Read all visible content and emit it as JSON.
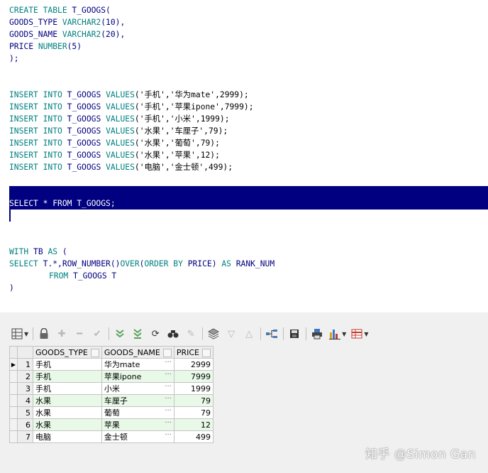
{
  "editor": {
    "create": {
      "l1": {
        "kw": "CREATE TABLE",
        "rest": " T_GOOGS("
      },
      "l2": {
        "name": "GOODS_TYPE ",
        "type": "VARCHAR2",
        "args": "(10),"
      },
      "l3": {
        "name": "GOODS_NAME ",
        "type": "VARCHAR2",
        "args": "(20),"
      },
      "l4": {
        "name": "PRICE ",
        "type": "NUMBER",
        "args": "(5)"
      },
      "l5": ");"
    },
    "inserts": [
      {
        "kw1": "INSERT",
        "kw2": "INTO",
        "table": "T_GOOGS",
        "values_kw": "VALUES",
        "args": "('手机','华为mate',2999);"
      },
      {
        "kw1": "INSERT",
        "kw2": "INTO",
        "table": "T_GOOGS",
        "values_kw": "VALUES",
        "args": "('手机','苹果ipone',7999);"
      },
      {
        "kw1": "INSERT",
        "kw2": "INTO",
        "table": "T_GOOGS",
        "values_kw": "VALUES",
        "args": "('手机','小米',1999);"
      },
      {
        "kw1": "INSERT",
        "kw2": "INTO",
        "table": "T_GOOGS",
        "values_kw": "VALUES",
        "args": "('水果','车厘子',79);"
      },
      {
        "kw1": "INSERT",
        "kw2": "INTO",
        "table": "T_GOOGS",
        "values_kw": "VALUES",
        "args": "('水果','葡萄',79);"
      },
      {
        "kw1": "INSERT",
        "kw2": "INTO",
        "table": "T_GOOGS",
        "values_kw": "VALUES",
        "args": "('水果','苹果',12);"
      },
      {
        "kw1": "INSERT",
        "kw2": "INTO",
        "table": "T_GOOGS",
        "values_kw": "VALUES",
        "args": "('电脑','金士顿',499);"
      }
    ],
    "select": "SELECT * FROM T_GOOGS;",
    "with": {
      "l1": {
        "kw": "WITH",
        "mid": " TB ",
        "kw2": "AS",
        "rest": " ("
      },
      "l2": {
        "kw": "SELECT",
        "mid": " T.*,ROW_NUMBER()",
        "kw2": "OVER",
        "p1": "(",
        "kw3": "ORDER BY",
        "p2": " PRICE) ",
        "kw4": "AS",
        "rest": " RANK_NUM"
      },
      "l3": {
        "kw": "FROM",
        "rest": " T_GOOGS T"
      },
      "l4": ")"
    }
  },
  "grid": {
    "columns": [
      "GOODS_TYPE",
      "GOODS_NAME",
      "PRICE"
    ],
    "rows": [
      {
        "n": "1",
        "type": "手机",
        "name": "华为mate",
        "price": "2999"
      },
      {
        "n": "2",
        "type": "手机",
        "name": "苹果ipone",
        "price": "7999"
      },
      {
        "n": "3",
        "type": "手机",
        "name": "小米",
        "price": "1999"
      },
      {
        "n": "4",
        "type": "水果",
        "name": "车厘子",
        "price": "79"
      },
      {
        "n": "5",
        "type": "水果",
        "name": "葡萄",
        "price": "79"
      },
      {
        "n": "6",
        "type": "水果",
        "name": "苹果",
        "price": "12"
      },
      {
        "n": "7",
        "type": "电脑",
        "name": "金士顿",
        "price": "499"
      }
    ],
    "cell_button": "···",
    "current_row_marker": "▶"
  },
  "toolbar": {
    "icons": [
      "grid-layout-icon",
      "lock-icon",
      "add-record-icon",
      "delete-record-icon",
      "post-changes-icon",
      "fetch-next-icon",
      "fetch-all-icon",
      "refresh-icon",
      "find-icon",
      "clear-icon",
      "query-by-example-icon",
      "filter-icon",
      "previous-icon",
      "link-icon",
      "save-icon",
      "print-icon",
      "chart-icon",
      "export-icon"
    ]
  },
  "watermark": "知乎 @Simon Gan",
  "colors": {
    "keyword": "#008080",
    "identifier": "#000080",
    "number": "#0000a0",
    "selection": "#000080",
    "alt_row": "#e8f9e8"
  }
}
